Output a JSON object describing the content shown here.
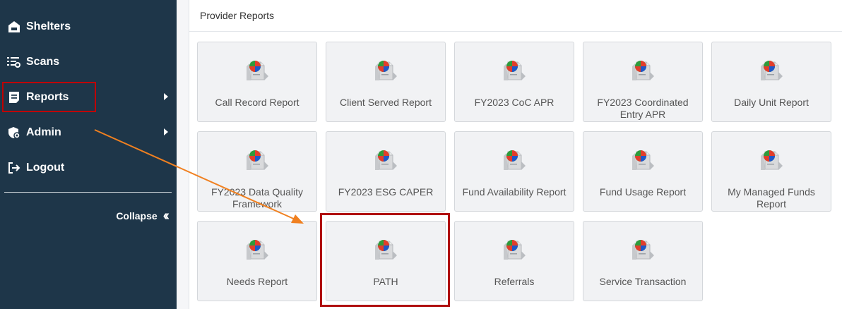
{
  "sidebar": {
    "items": [
      {
        "label": "Shelters",
        "icon": "home-icon",
        "has_submenu": false
      },
      {
        "label": "Scans",
        "icon": "list-scan-icon",
        "has_submenu": false
      },
      {
        "label": "Reports",
        "icon": "report-icon",
        "has_submenu": true
      },
      {
        "label": "Admin",
        "icon": "shield-icon",
        "has_submenu": true
      },
      {
        "label": "Logout",
        "icon": "logout-icon",
        "has_submenu": false
      }
    ],
    "collapse_label": "Collapse",
    "collapse_icon": "double-chevron-left-icon"
  },
  "panel": {
    "title": "Provider Reports",
    "reports": [
      {
        "label": "Call Record Report"
      },
      {
        "label": "Client Served Report"
      },
      {
        "label": "FY2023 CoC APR"
      },
      {
        "label": "FY2023 Coordinated Entry APR"
      },
      {
        "label": "Daily Unit Report"
      },
      {
        "label": "FY2023 Data Quality Framework"
      },
      {
        "label": "FY2023 ESG CAPER"
      },
      {
        "label": "Fund Availability Report"
      },
      {
        "label": "Fund Usage Report"
      },
      {
        "label": "My Managed Funds Report"
      },
      {
        "label": "Needs Report"
      },
      {
        "label": "PATH"
      },
      {
        "label": "Referrals"
      },
      {
        "label": "Service Transaction"
      }
    ],
    "report_icon": "report-chart-icon"
  },
  "colors": {
    "sidebar_bg": "#1e3649",
    "highlight": "#c00000",
    "arrow": "#f08020"
  }
}
